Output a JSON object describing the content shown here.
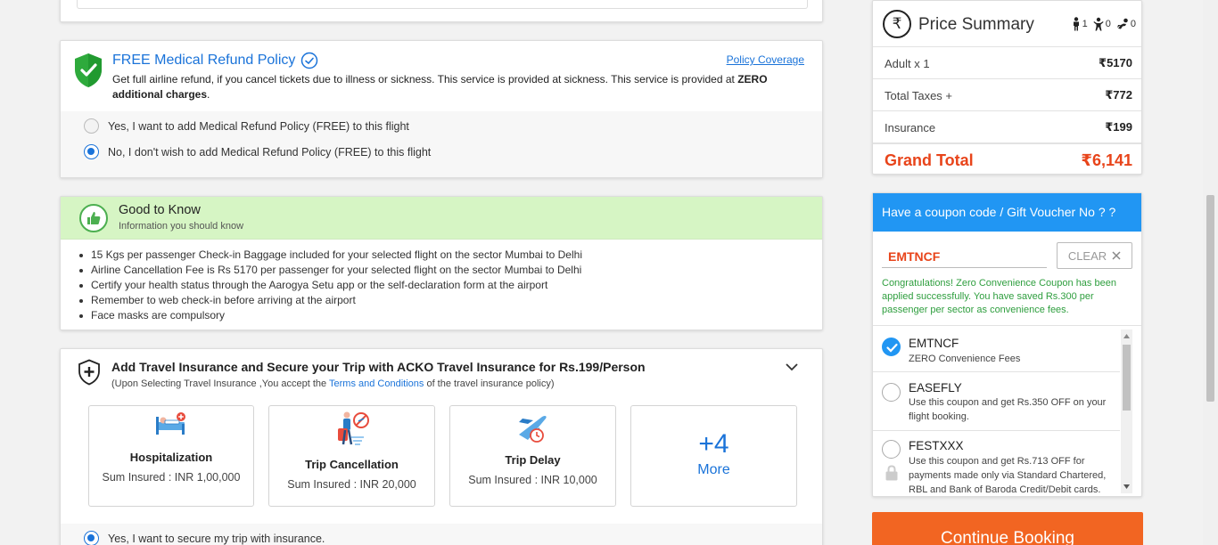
{
  "medical": {
    "title": "FREE Medical Refund Policy",
    "policy_link": "Policy Coverage",
    "desc_main": "Get full airline refund, if you cancel tickets due to illness or sickness. This service is provided at sickness. This service is provided at ",
    "desc_bold": "ZERO additional charges",
    "desc_end": ".",
    "option_yes": "Yes, I want to add Medical Refund Policy (FREE) to this flight",
    "option_no": "No, I don't wish to add Medical Refund Policy (FREE) to this flight",
    "selected": "no"
  },
  "good_to_know": {
    "title": "Good to Know",
    "subtitle": "Information you should know",
    "items": [
      "15 Kgs per passenger Check-in Baggage included for your selected flight on the sector  Mumbai to Delhi",
      "Airline Cancellation Fee is Rs 5170 per passenger for your selected flight on the sector Mumbai to Delhi",
      "Certify your health status through the Aarogya Setu app or the self-declaration form at the airport",
      "Remember to web check-in before arriving at the airport",
      "Face masks are compulsory"
    ]
  },
  "insurance": {
    "title": "Add Travel Insurance and Secure your Trip with ACKO Travel Insurance for Rs.199/Person",
    "sub_before": "(Upon Selecting Travel Insurance ,You accept the ",
    "sub_link": "Terms and Conditions",
    "sub_after": " of the travel insurance policy)",
    "tiles": [
      {
        "name": "Hospitalization",
        "sum": "Sum Insured : INR 1,00,000",
        "icon": "hospital-bed-icon"
      },
      {
        "name": "Trip Cancellation",
        "sum": "Sum Insured : INR 20,000",
        "icon": "trip-cancel-icon"
      },
      {
        "name": "Trip Delay",
        "sum": "Sum Insured : INR 10,000",
        "icon": "plane-delay-icon"
      }
    ],
    "more_count": "+4",
    "more_label": "More",
    "option_yes": "Yes, I want to secure my trip with insurance."
  },
  "price_summary": {
    "title": "Price Summary",
    "currency_symbol": "₹",
    "pax": {
      "adults": "1",
      "children": "0",
      "infants": "0"
    },
    "rows": [
      {
        "label": "Adult x 1",
        "value": "5170"
      },
      {
        "label": "Total Taxes +",
        "value": "772"
      },
      {
        "label": "Insurance",
        "value": "199"
      }
    ],
    "grand_label": "Grand Total",
    "grand_value": "6,141"
  },
  "coupon": {
    "header": "Have a coupon code / Gift Voucher No ? ?",
    "code_value": "EMTNCF",
    "clear_label": "CLEAR",
    "success_msg": "Congratulations! Zero Convenience Coupon has been applied successfully. You have saved Rs.300 per passenger per sector as convenience fees.",
    "items": [
      {
        "code": "EMTNCF",
        "desc": "ZERO Convenience Fees",
        "selected": true
      },
      {
        "code": "EASEFLY",
        "desc": "Use this coupon and get Rs.350 OFF on your flight booking.",
        "selected": false
      },
      {
        "code": "FESTXXX",
        "desc": "Use this coupon and get Rs.713 OFF for payments made only via Standard Chartered, RBL and Bank of Baroda Credit/Debit cards.",
        "selected": false
      }
    ]
  },
  "continue_label": "Continue Booking",
  "colors": {
    "accent": "#1a73d9",
    "orange": "#f26522",
    "grand_total": "#e8441a",
    "green_bar": "#d6f5c4",
    "coupon_header": "#2196f3"
  }
}
